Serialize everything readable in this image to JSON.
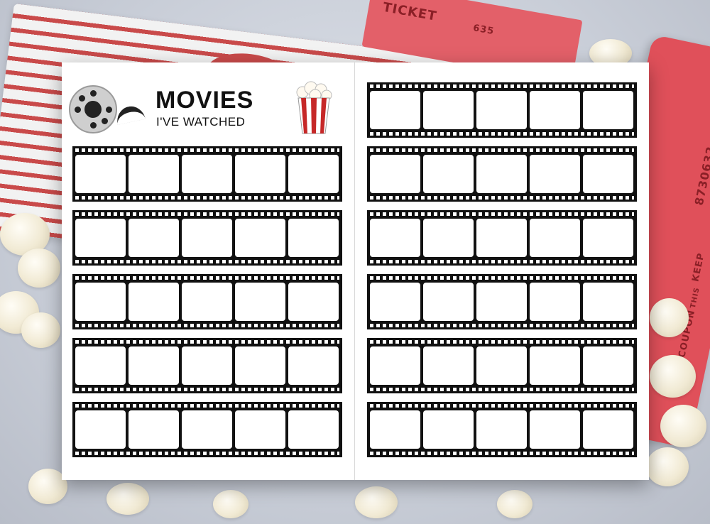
{
  "planner": {
    "title": "MOVIES",
    "subtitle": "I'VE WATCHED"
  },
  "background": {
    "ticket_word": "TICKET",
    "ticket_number": "8730632",
    "ticket_number_fragment": "635",
    "coupon_text_1": "KEEP",
    "coupon_text_2": "THIS",
    "coupon_text_3": "COUPON"
  },
  "layout_info": {
    "left_page_strips": 5,
    "right_page_strips": 6,
    "frames_per_strip": 5
  },
  "colors": {
    "film": "#111111",
    "popcorn_box_red": "#c62828",
    "ticket_red": "#e0505a"
  }
}
